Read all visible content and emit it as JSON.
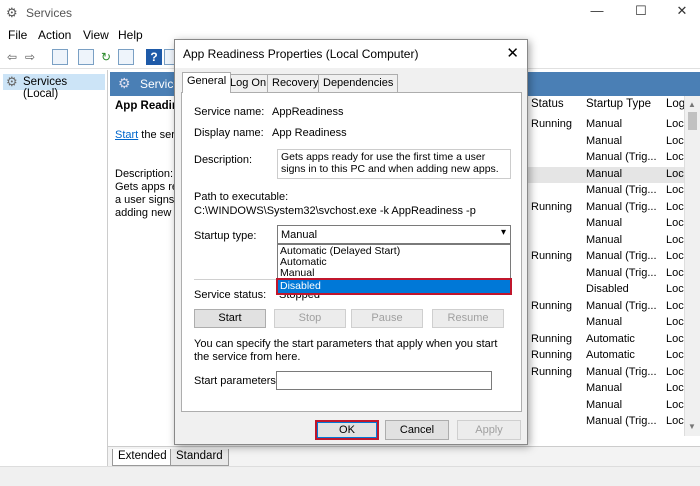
{
  "window": {
    "title": "Services",
    "minimize": "—",
    "maximize": "☐",
    "close": "✕"
  },
  "menu": [
    "File",
    "Action",
    "View",
    "Help"
  ],
  "tree": {
    "root": "Services (Local)"
  },
  "main_header": "Services (Local)",
  "detail": {
    "service_title": "App Readiness",
    "start_link": "Start",
    "start_rest": " the service",
    "description_label": "Description:",
    "description_lines": [
      "Gets apps ready for use",
      "a user signs in",
      "adding new apps."
    ]
  },
  "columns": {
    "status": "Status",
    "startup_type": "Startup Type",
    "log_on": "Log"
  },
  "rows": [
    {
      "status": "Running",
      "startup": "Manual",
      "log": "Loca"
    },
    {
      "status": "",
      "startup": "Manual",
      "log": "Loca"
    },
    {
      "status": "",
      "startup": "Manual (Trig...",
      "log": "Loca"
    },
    {
      "status": "",
      "startup": "Manual",
      "log": "Loca",
      "selected": true
    },
    {
      "status": "",
      "startup": "Manual (Trig...",
      "log": "Loca"
    },
    {
      "status": "Running",
      "startup": "Manual (Trig...",
      "log": "Loca"
    },
    {
      "status": "",
      "startup": "Manual",
      "log": "Loca"
    },
    {
      "status": "",
      "startup": "Manual",
      "log": "Loca"
    },
    {
      "status": "Running",
      "startup": "Manual (Trig...",
      "log": "Loca"
    },
    {
      "status": "",
      "startup": "Manual (Trig...",
      "log": "Loca"
    },
    {
      "status": "",
      "startup": "Disabled",
      "log": "Loca"
    },
    {
      "status": "Running",
      "startup": "Manual (Trig...",
      "log": "Loca"
    },
    {
      "status": "",
      "startup": "Manual",
      "log": "Loca"
    },
    {
      "status": "Running",
      "startup": "Automatic",
      "log": "Loca"
    },
    {
      "status": "Running",
      "startup": "Automatic",
      "log": "Loca"
    },
    {
      "status": "Running",
      "startup": "Manual (Trig...",
      "log": "Loca"
    },
    {
      "status": "",
      "startup": "Manual",
      "log": "Loca"
    },
    {
      "status": "",
      "startup": "Manual",
      "log": "Loca"
    },
    {
      "status": "",
      "startup": "Manual (Trig...",
      "log": "Loca"
    }
  ],
  "bottom_tabs": [
    "Extended",
    "Standard"
  ],
  "dialog": {
    "title": "App Readiness Properties (Local Computer)",
    "close": "✕",
    "tabs": [
      "General",
      "Log On",
      "Recovery",
      "Dependencies"
    ],
    "service_name_label": "Service name:",
    "service_name": "AppReadiness",
    "display_name_label": "Display name:",
    "display_name": "App Readiness",
    "description_label": "Description:",
    "description": "Gets apps ready for use the first time a user signs in to this PC and when adding new apps.",
    "path_label": "Path to executable:",
    "path": "C:\\WINDOWS\\System32\\svchost.exe -k AppReadiness -p",
    "startup_type_label": "Startup type:",
    "startup_type_value": "Manual",
    "startup_options": [
      "Automatic (Delayed Start)",
      "Automatic",
      "Manual",
      "Disabled"
    ],
    "highlighted_option": "Disabled",
    "service_status_label": "Service status:",
    "service_status": "Stopped",
    "buttons": {
      "start": "Start",
      "stop": "Stop",
      "pause": "Pause",
      "resume": "Resume"
    },
    "params_hint": "You can specify the start parameters that apply when you start the service from here.",
    "start_params_label": "Start parameters:",
    "ok": "OK",
    "cancel": "Cancel",
    "apply": "Apply"
  },
  "colors": {
    "accent": "#0078d7",
    "highlight_outline": "#c0162c",
    "header_blue": "#4a7fb5"
  }
}
